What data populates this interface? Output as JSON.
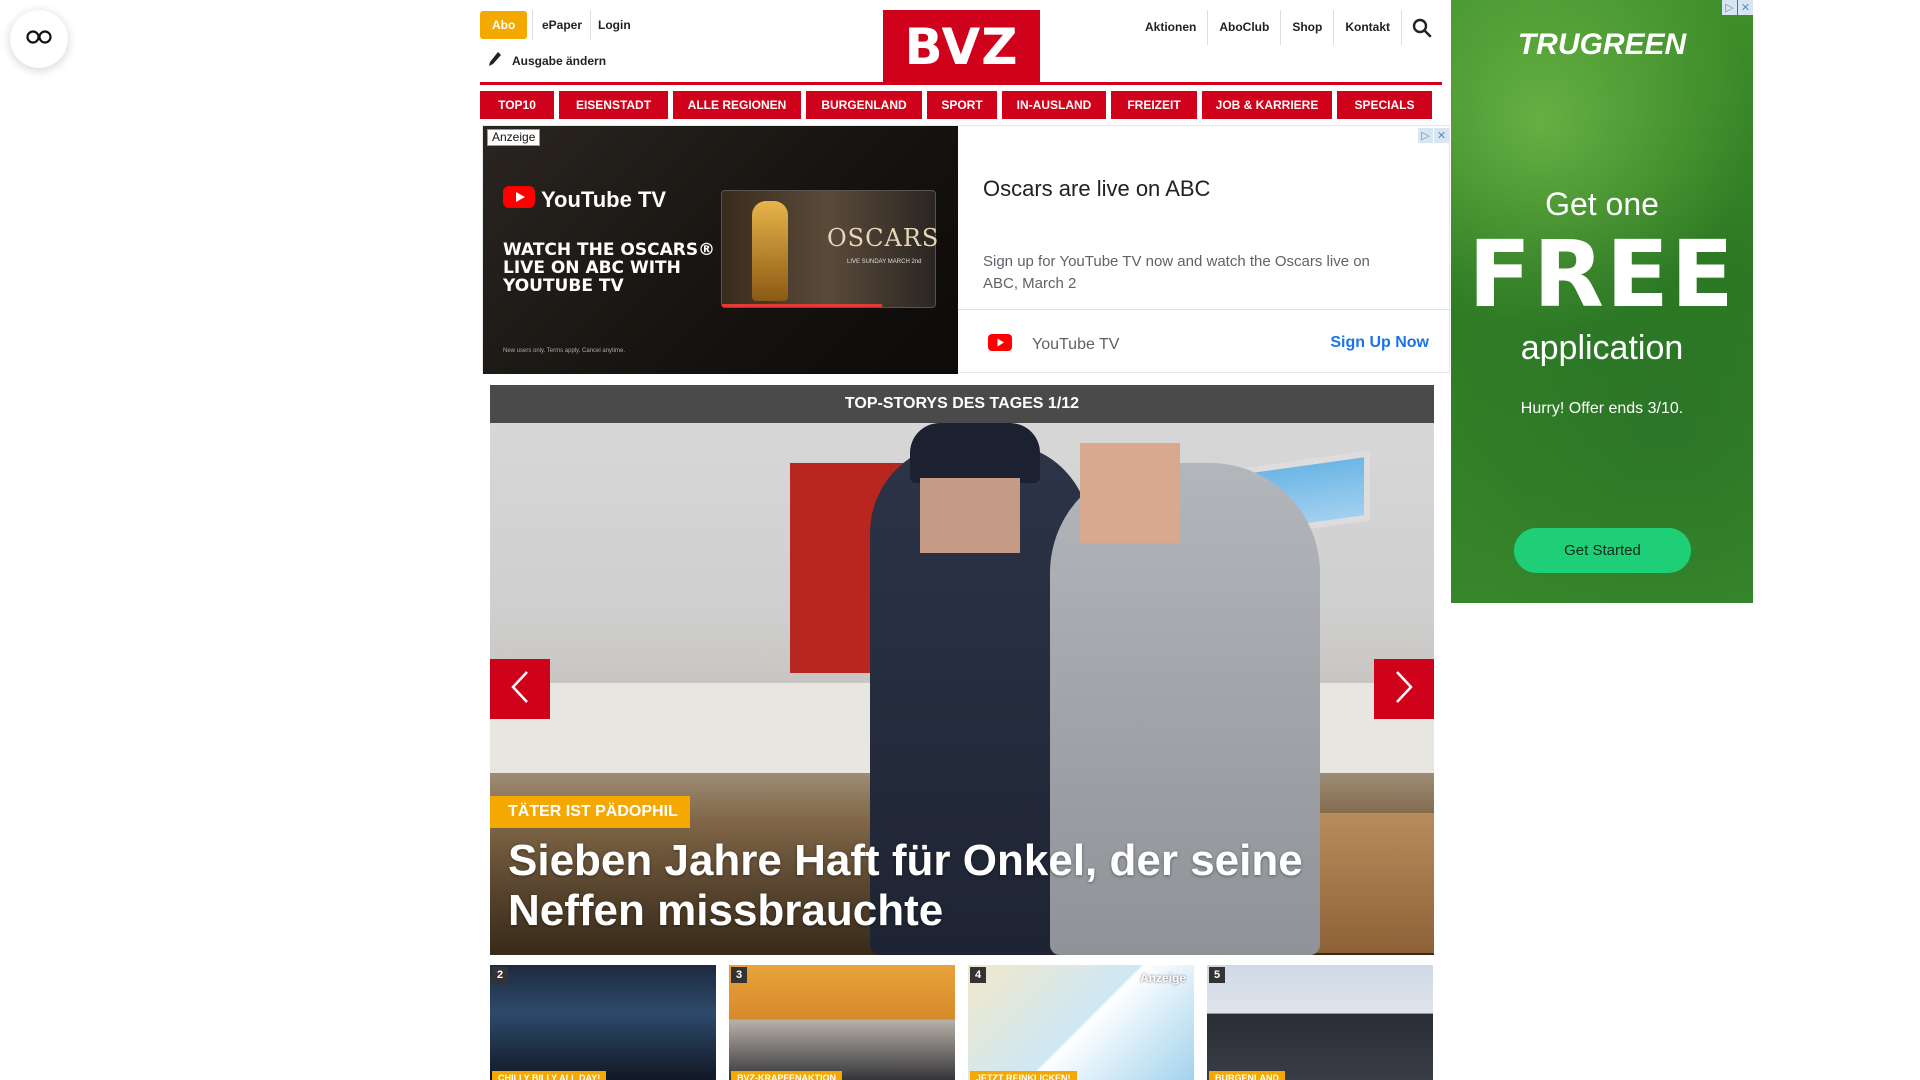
{
  "header": {
    "abo_label": "Abo",
    "epaper_label": "ePaper",
    "login_label": "Login",
    "ausgabe_label": "Ausgabe ändern",
    "logo_text": "BVZ",
    "right_links": [
      "Aktionen",
      "AboClub",
      "Shop",
      "Kontakt"
    ]
  },
  "nav": {
    "items": [
      "TOP10",
      "EISENSTADT",
      "ALLE REGIONEN",
      "BURGENLAND",
      "SPORT",
      "IN-AUSLAND",
      "FREIZEIT",
      "JOB & KARRIERE",
      "SPECIALS"
    ]
  },
  "ad_banner": {
    "label": "Anzeige",
    "brand_logo_text": "YouTube TV",
    "image_headline": "WATCH THE OSCARS® LIVE ON ABC WITH YOUTUBE TV",
    "image_card_word": "OSCARS",
    "image_card_sub": "LIVE SUNDAY MARCH 2nd",
    "image_fineprint": "New users only. Terms apply. Cancel anytime.",
    "title": "Oscars are live on ABC",
    "description": "Sign up for YouTube TV now and watch the Oscars live on ABC, March 2",
    "advertiser": "YouTube TV",
    "cta": "Sign Up Now",
    "adchoices": [
      "▷",
      "✕"
    ]
  },
  "top_stories": {
    "bar_title": "TOP-STORYS DES TAGES 1/12",
    "hero": {
      "kicker": "TÄTER IST PÄDOPHIL",
      "headline": "Sieben Jahre Haft für Onkel, der seine Neffen missbrauchte"
    },
    "thumbs": [
      {
        "num": "2",
        "tag": "CHILLY BILLY ALL DAY!"
      },
      {
        "num": "3",
        "tag": "BVZ-KRAPFENAKTION"
      },
      {
        "num": "4",
        "tag": "JETZT REINKLICKEN!",
        "anzeige": "Anzeige"
      },
      {
        "num": "5",
        "tag": "BURGENLAND"
      }
    ]
  },
  "sky_ad": {
    "logo": "TRUGREEN",
    "line1": "Get one",
    "line2": "FREE",
    "line3": "application",
    "hurry": "Hurry! Offer ends 3/10.",
    "cta": "Get Started",
    "adchoices": [
      "▷",
      "✕"
    ]
  },
  "colors": {
    "brand_red": "#d0021b",
    "accent_yellow": "#f5a800",
    "cta_green": "#1fcf78",
    "link_blue": "#1a73e8"
  }
}
